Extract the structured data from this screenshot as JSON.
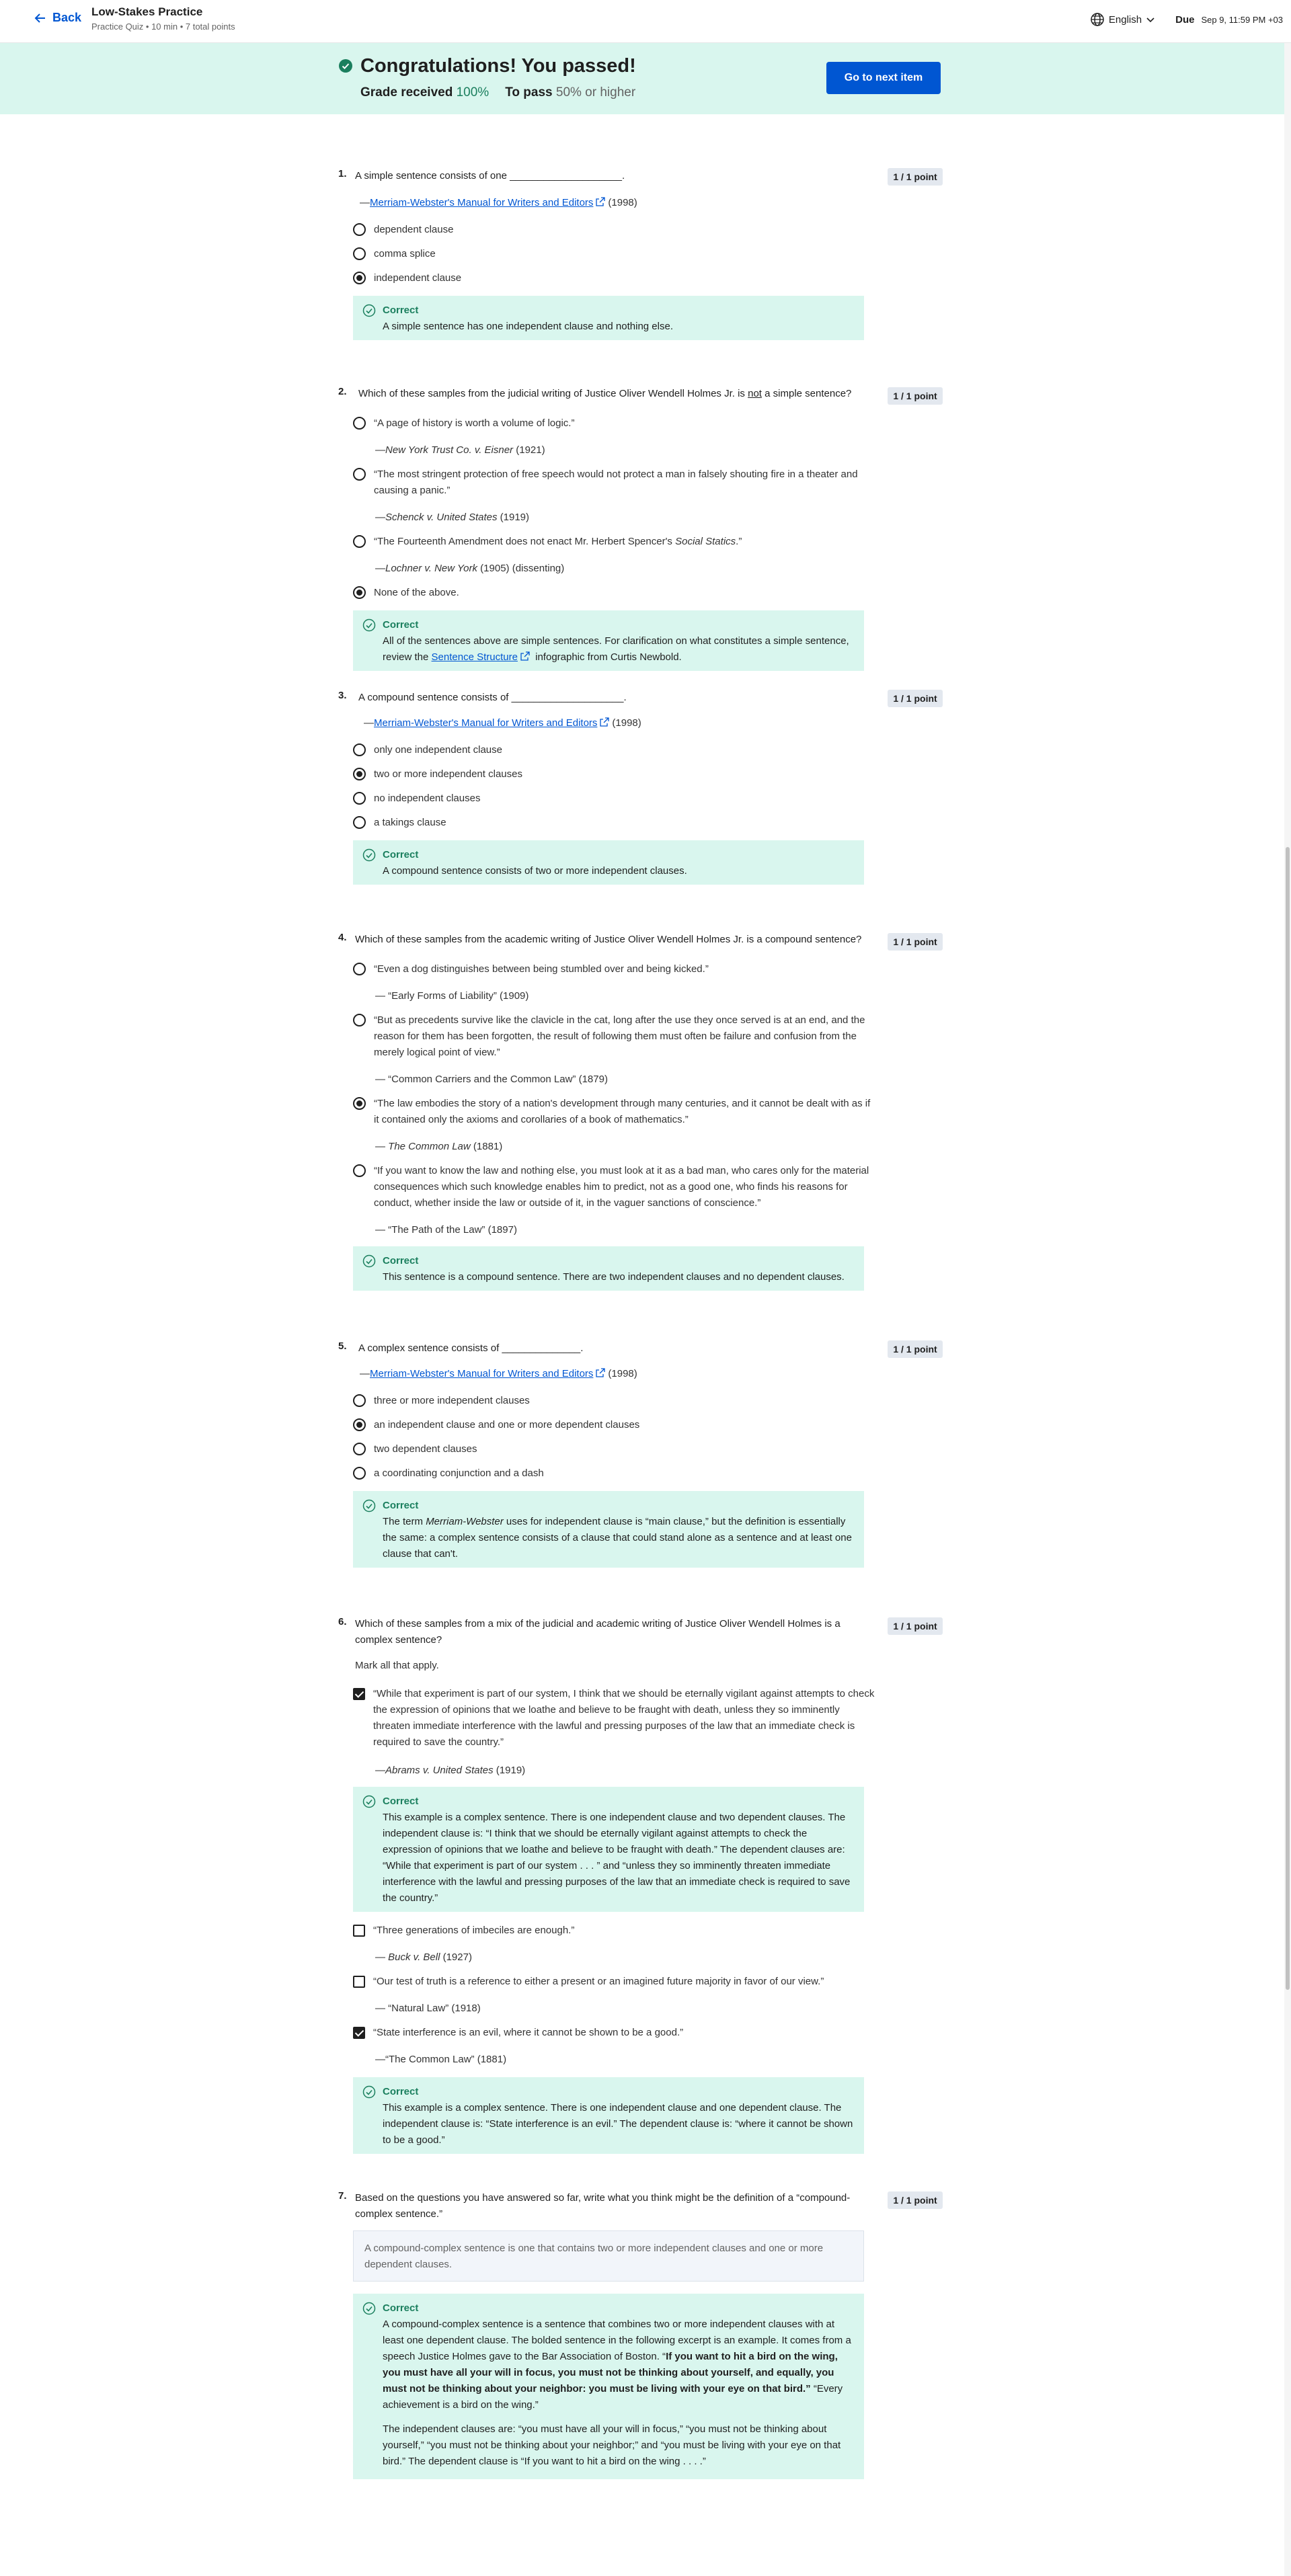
{
  "header": {
    "back_label": "Back",
    "title": "Low-Stakes Practice",
    "subtitle": "Practice Quiz • 10 min • 7 total points",
    "language": "English",
    "due_label": "Due",
    "due_date": "Sep 9, 11:59 PM +03"
  },
  "banner": {
    "title": "Congratulations! You passed!",
    "grade_label": "Grade received",
    "grade_value": "100%",
    "pass_label": "To pass",
    "pass_value": "50% or higher",
    "next_button": "Go to next item"
  },
  "feedback_title": "Correct",
  "q1": {
    "num": "1.",
    "text": "A simple sentence consists of one ____________________.",
    "points": "1 / 1 point",
    "cite_prefix": "—",
    "cite_link": "Merriam-Webster's Manual for Writers and Editors",
    "cite_year": "(1998)",
    "options": [
      "dependent clause",
      "comma splice",
      "independent clause"
    ],
    "feedback": "A simple sentence has one independent clause and nothing else."
  },
  "q2": {
    "num": "2.",
    "text_a": "Which of these samples from the judicial writing of Justice Oliver Wendell Holmes Jr. is ",
    "text_not": "not",
    "text_b": " a simple sentence?",
    "points": "1 / 1 point",
    "opt1": "“A page of history is worth a volume of logic.”",
    "src1_a": "—",
    "src1_i": "New York Trust Co. v. Eisner",
    "src1_b": " (1921)",
    "opt2": "“The most stringent protection of free speech would not protect a man in falsely shouting fire in a theater and causing a panic.”",
    "src2_a": "—",
    "src2_i": "Schenck v. United States",
    "src2_b": " (1919)",
    "opt3_a": "“The Fourteenth Amendment does not enact Mr. Herbert Spencer's ",
    "opt3_i": "Social Statics",
    "opt3_b": ".”",
    "src3_a": "—",
    "src3_i": "Lochner v. New York",
    "src3_b": " (1905) (dissenting)",
    "opt4": "None of the above.",
    "fb_a": "All of the sentences above are simple sentences. For clarification on what constitutes a simple sentence, review the ",
    "fb_link": "Sentence Structure",
    "fb_b": " infographic from Curtis Newbold."
  },
  "q3": {
    "num": "3.",
    "text": "A compound sentence consists of ____________________.",
    "points": "1 / 1 point",
    "cite_prefix": "—",
    "cite_link": "Merriam-Webster's Manual for Writers and Editors",
    "cite_year": "(1998)",
    "options": [
      "only one independent clause",
      "two or more independent clauses",
      "no independent clauses",
      "a takings clause"
    ],
    "feedback": "A compound sentence consists of two or more independent clauses."
  },
  "q4": {
    "num": "4.",
    "text": "Which of these samples from the academic writing of Justice Oliver Wendell Holmes Jr. is a compound sentence?",
    "points": "1 / 1 point",
    "opt1": "“Even a dog distinguishes between being stumbled over and being kicked.”",
    "src1": "— “Early Forms of Liability” (1909)",
    "opt2": "“But as precedents survive like the clavicle in the cat, long after the use they once served is at an end, and the reason for them has been forgotten, the result of following them must often be failure and confusion from the merely logical point of view.”",
    "src2": "— “Common Carriers and the Common Law” (1879)",
    "opt3": "“The law embodies the story of a nation's development through many centuries, and it cannot be dealt with as if it contained only the axioms and corollaries of a book of mathematics.”",
    "src3_a": "— ",
    "src3_i": "The Common Law",
    "src3_b": " (1881)",
    "opt4": "“If you want to know the law and nothing else, you must look at it as a bad man, who cares only for the material consequences which such knowledge enables him to predict, not as a good one, who finds his reasons for conduct, whether inside the law or outside of it, in the vaguer sanctions of conscience.”",
    "src4": "— “The Path of the Law” (1897)",
    "feedback": "This sentence is a compound sentence. There are two independent clauses and no dependent clauses."
  },
  "q5": {
    "num": "5.",
    "text": "A complex sentence consists of ______________.",
    "points": "1 / 1 point",
    "cite_prefix": "—",
    "cite_link": "Merriam-Webster's Manual for Writers and Editors",
    "cite_year": "(1998)",
    "options": [
      "three or more independent clauses",
      "an independent clause and one or more dependent clauses",
      "two dependent clauses",
      "a coordinating conjunction and a dash"
    ],
    "fb_a": "The term ",
    "fb_i": "Merriam-Webster",
    "fb_b": " uses for independent clause is “main clause,” but the definition is essentially the same: a complex sentence consists of a clause that could stand alone as a sentence and at least one clause that can't."
  },
  "q6": {
    "num": "6.",
    "text": "Which of these samples from a mix of the judicial and academic writing of Justice Oliver Wendell Holmes is a complex sentence?",
    "points": "1 / 1 point",
    "instruction": "Mark all that apply.",
    "opt1": "“While that experiment is part of our system, I think that we should be eternally vigilant against attempts to check the expression of opinions that we loathe and believe to be fraught with death, unless they so imminently threaten immediate interference with the lawful and pressing purposes of the law that an immediate check is required to save the country.”",
    "src1_a": "—",
    "src1_i": "Abrams v. United States",
    "src1_b": " (1919)",
    "fb1": "This example is a complex sentence. There is one independent clause and two dependent clauses. The independent clause is: “I think that we should be eternally vigilant against attempts to check the expression of opinions that we loathe and believe to be fraught with death.” The dependent clauses are: “While that experiment is part of our system . . . ” and “unless they so imminently threaten immediate interference with the lawful and pressing purposes of the law that an immediate check is required to save the country.”",
    "opt2": "“Three generations of imbeciles are enough.”",
    "src2_a": "— ",
    "src2_i": "Buck v. Bell",
    "src2_b": " (1927)",
    "opt3": "“Our test of truth is a reference to either a present or an imagined future majority in favor of our view.”",
    "src3": "— “Natural Law” (1918)",
    "opt4": "“State interference is an evil, where it cannot be shown to be a good.”",
    "src4": "—“The Common Law” (1881)",
    "fb4": "This example is a complex sentence. There is one independent clause and one dependent clause. The independent clause is: “State interference is an evil.” The dependent clause is: “where it cannot be shown to be a good.”"
  },
  "q7": {
    "num": "7.",
    "text": "Based on the questions you have answered so far, write what you think might be the definition of a “compound-complex sentence.”",
    "points": "1 / 1 point",
    "answer": "A compound-complex sentence is one that contains two or more independent clauses and one or more dependent clauses.",
    "fb_a": "A compound-complex sentence is a sentence that combines two or more independent clauses with at least one dependent clause. The bolded sentence in the following excerpt is an example. It comes from a speech Justice Holmes gave to the Bar Association of Boston. “",
    "fb_bold": "If you want to hit a bird on the wing, you must have all your will in focus, you must not be thinking about yourself, and equally, you must not be thinking about your neighbor: you must be living with your eye on that bird.” ",
    "fb_b": "“Every achievement is a bird on the wing.”",
    "fb2": "The independent clauses are: “you must have all your will in focus,” “you must not be thinking about yourself,” “you must not be thinking about your neighbor;” and “you must be living with your eye on that bird.” The dependent clause is “If you want to hit a bird on the wing . . . .”"
  }
}
